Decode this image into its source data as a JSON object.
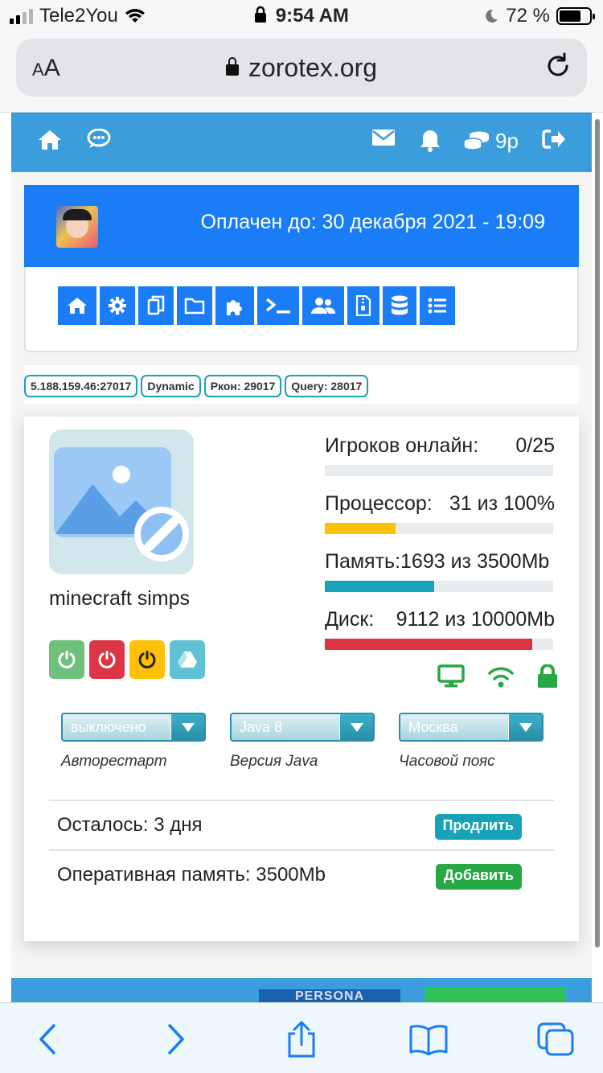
{
  "status_bar": {
    "carrier": "Tele2You",
    "time": "9:54 AM",
    "battery": "72 %",
    "battery_level": 0.72
  },
  "browser": {
    "text_size_label_small": "A",
    "text_size_label_large": "A",
    "url": "zorotex.org"
  },
  "topnav": {
    "coins": "9р"
  },
  "header": {
    "paid_until": "Оплачен до: 30 декабря 2021 - 19:09"
  },
  "toolbar": {
    "icons": [
      "home-icon",
      "gear-icon",
      "copy-icon",
      "folder-icon",
      "puzzle-icon",
      "terminal-icon",
      "users-icon",
      "file-archive-icon",
      "database-icon",
      "list-icon"
    ]
  },
  "badges": {
    "address": "5.188.159.46:27017",
    "ip_type": "Dynamic",
    "rcon": "Ркон: 29017",
    "query": "Query: 28017"
  },
  "server": {
    "name": "minecraft simps"
  },
  "stats": [
    {
      "label": "Игроков онлайн:",
      "value": "0/25",
      "fraction": 0.0,
      "color": "#e9ecef"
    },
    {
      "label": "Процессор:",
      "value": "31 из 100%",
      "fraction": 0.31,
      "color": "#ffc107"
    },
    {
      "label": "Память:",
      "value": "1693 из 3500Mb",
      "fraction": 0.48,
      "color": "#17a2b8"
    },
    {
      "label": "Диск:",
      "value": "9112 из 10000Mb",
      "fraction": 0.91,
      "color": "#dc3545"
    }
  ],
  "controls": {
    "start_color": "#6ec07a",
    "stop_color": "#dc3545",
    "restart_color": "#ffc107",
    "drive_color": "#5fc1d3"
  },
  "settings": {
    "autorestart": {
      "value": "выключено",
      "caption": "Авторестарт"
    },
    "java": {
      "value": "Java 8",
      "caption": "Версия Java"
    },
    "timezone": {
      "value": "Москва",
      "caption": "Часовой пояс"
    }
  },
  "billing": {
    "remaining": "Осталось: 3 дня",
    "extend_label": "Продлить",
    "ram": "Оперативная память: 3500Mb",
    "add_label": "Добавить"
  },
  "ads": {
    "banner_text": "PERSONA"
  },
  "colors": {
    "nav_blue": "#3b9ddb",
    "primary": "#1a7df6",
    "success": "#28a745",
    "info": "#17a2b8"
  }
}
